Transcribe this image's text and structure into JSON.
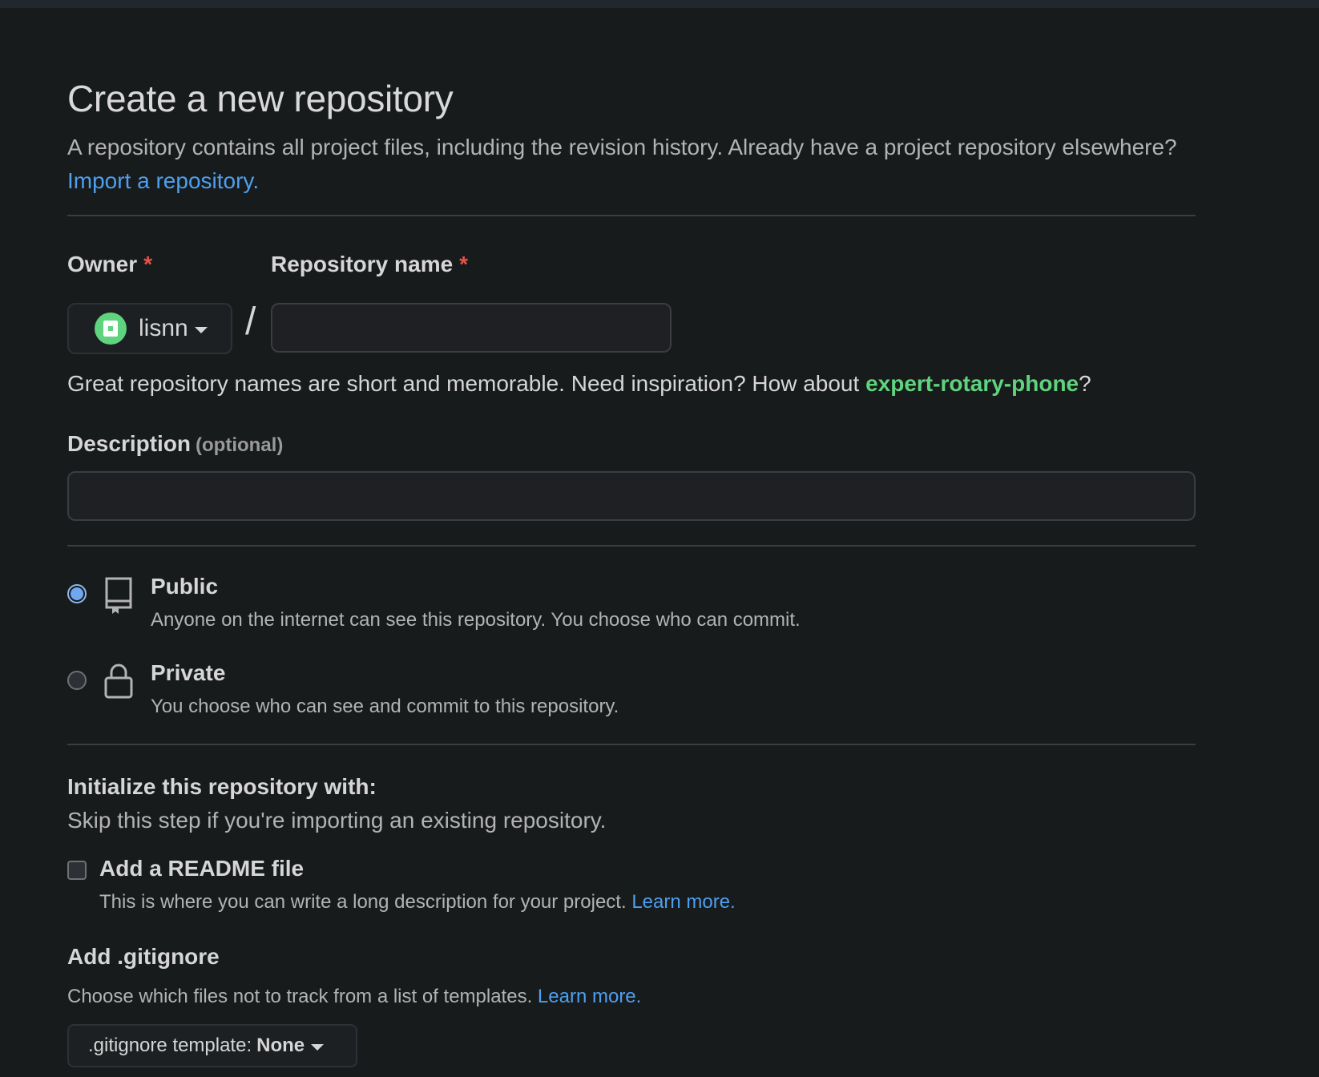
{
  "header": {
    "title": "Create a new repository",
    "lead_text": "A repository contains all project files, including the revision history. Already have a project repository elsewhere?",
    "import_link": "Import a repository."
  },
  "owner": {
    "label": "Owner",
    "required_mark": "*",
    "value": "lisnn",
    "avatar_color": "#5fd37d"
  },
  "repo_name": {
    "label": "Repository name",
    "required_mark": "*",
    "value": "",
    "separator": "/"
  },
  "name_hint": {
    "prefix": "Great repository names are short and memorable. Need inspiration? How about ",
    "suggestion": "expert-rotary-phone",
    "suffix": "?"
  },
  "description": {
    "label": "Description",
    "optional": "(optional)",
    "value": ""
  },
  "visibility": {
    "selected": "public",
    "public": {
      "title": "Public",
      "desc": "Anyone on the internet can see this repository. You choose who can commit.",
      "icon": "repo-icon"
    },
    "private": {
      "title": "Private",
      "desc": "You choose who can see and commit to this repository.",
      "icon": "lock-icon"
    }
  },
  "initialize": {
    "title": "Initialize this repository with:",
    "subtitle": "Skip this step if you're importing an existing repository.",
    "readme": {
      "label": "Add a README file",
      "checked": false,
      "desc": "This is where you can write a long description for your project.",
      "learn_more": "Learn more."
    },
    "gitignore": {
      "title": "Add .gitignore",
      "desc": "Choose which files not to track from a list of templates.",
      "learn_more": "Learn more.",
      "select_label": ".gitignore template:",
      "select_value": "None"
    }
  },
  "colors": {
    "background": "#181b1c",
    "link": "#4d9ff0",
    "accent_green": "#5fd37d",
    "required": "#e5534b"
  }
}
